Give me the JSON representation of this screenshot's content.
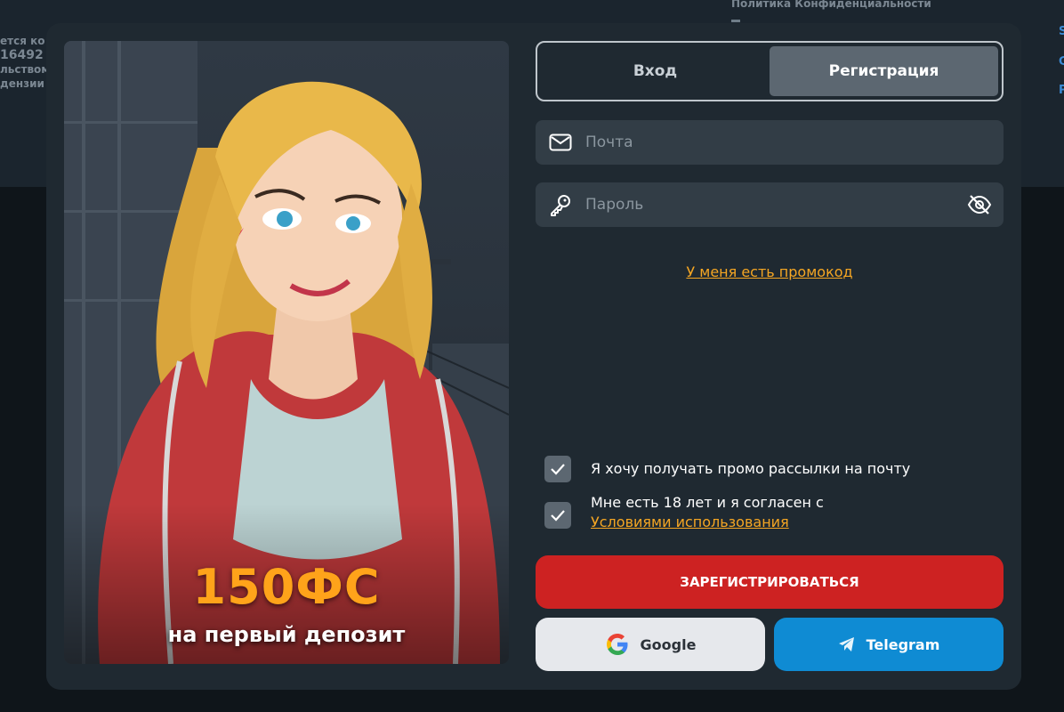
{
  "background": {
    "policy_link": "Политика Конфиденциальности",
    "left_lines": [
      "ется ко",
      "16492",
      "льством",
      "дензии"
    ],
    "right_chars": [
      "S",
      "G",
      "P"
    ]
  },
  "promo": {
    "amount": "150ФС",
    "subtitle": "на первый депозит"
  },
  "tabs": [
    {
      "label": "Вход",
      "active": false
    },
    {
      "label": "Регистрация",
      "active": true
    }
  ],
  "fields": {
    "email": {
      "placeholder": "Почта",
      "icon": "envelope-icon"
    },
    "password": {
      "placeholder": "Пароль",
      "icon": "key-icon",
      "toggle_icon": "eye-off-icon"
    }
  },
  "promo_code_link": "У меня есть промокод",
  "checkboxes": [
    {
      "text": "Я хочу получать промо рассылки на почту",
      "checked": true
    },
    {
      "text": "Мне есть 18 лет и я согласен с",
      "link": "Условиями использования",
      "checked": true
    }
  ],
  "buttons": {
    "register": "ЗАРЕГИСТРИРОВАТЬСЯ",
    "google": "Google",
    "telegram": "Telegram"
  },
  "colors": {
    "accent_orange": "#f5a623",
    "register_red": "#cd2222",
    "telegram_blue": "#0f8bd3"
  }
}
